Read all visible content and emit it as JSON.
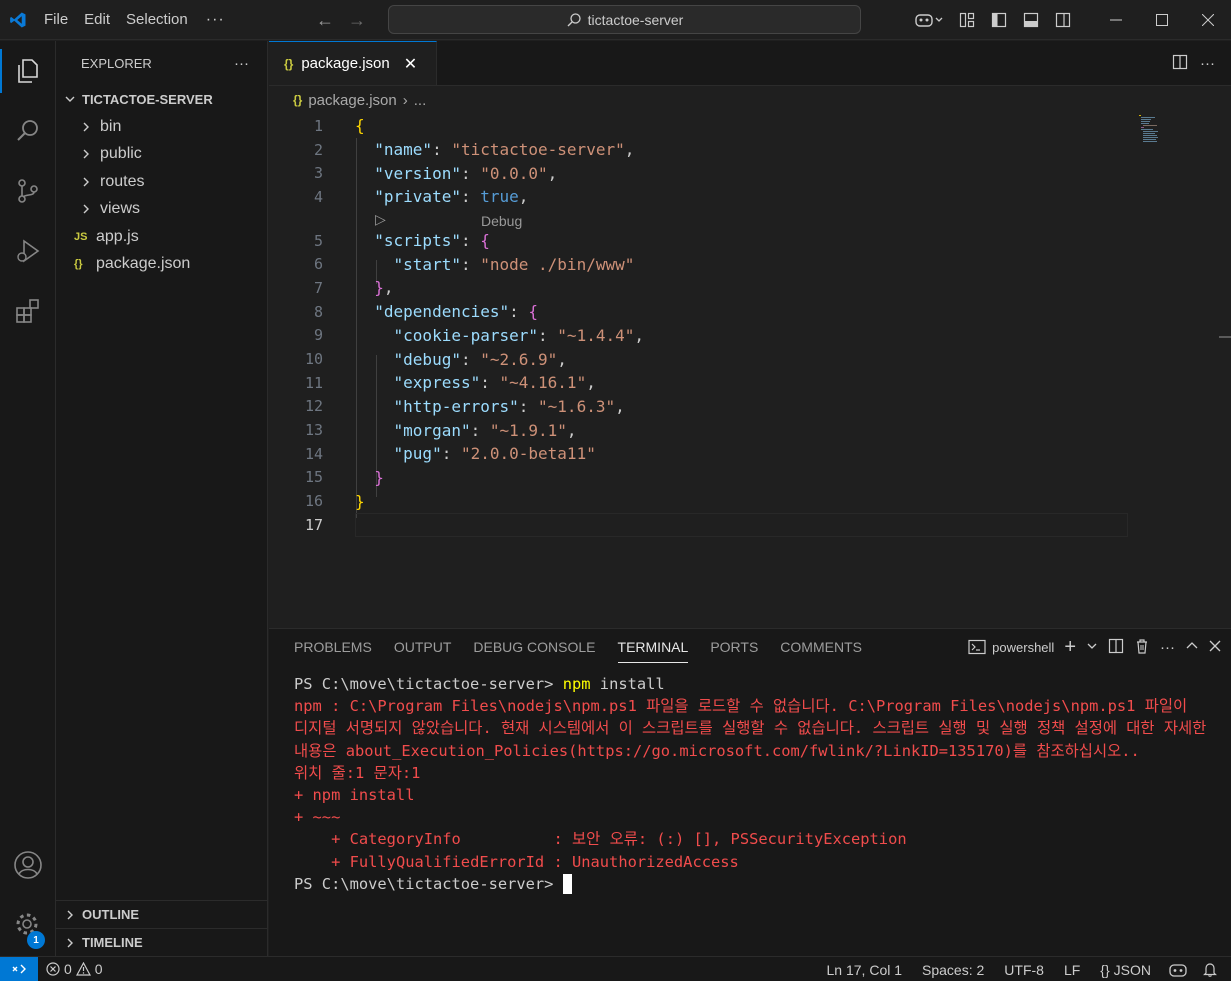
{
  "titlebar": {
    "menus": [
      "File",
      "Edit",
      "Selection"
    ],
    "more": "···",
    "search": "tictactoe-server"
  },
  "sidebar": {
    "title": "EXPLORER",
    "more": "···",
    "root": "TICTACTOE-SERVER",
    "items": [
      {
        "label": "bin",
        "type": "folder"
      },
      {
        "label": "public",
        "type": "folder"
      },
      {
        "label": "routes",
        "type": "folder"
      },
      {
        "label": "views",
        "type": "folder"
      },
      {
        "label": "app.js",
        "type": "js",
        "icon": "JS"
      },
      {
        "label": "package.json",
        "type": "json",
        "icon": "{}"
      }
    ],
    "outline": "OUTLINE",
    "timeline": "TIMELINE"
  },
  "activity": {
    "settings_badge": "1"
  },
  "editor": {
    "tab_label": "package.json",
    "tab_icon": "{}",
    "breadcrumb_file": "package.json",
    "breadcrumb_more": "...",
    "codelens": "Debug",
    "lines": [
      {
        "n": "1"
      },
      {
        "n": "2"
      },
      {
        "n": "3"
      },
      {
        "n": "4"
      },
      {
        "n": "5"
      },
      {
        "n": "6"
      },
      {
        "n": "7"
      },
      {
        "n": "8"
      },
      {
        "n": "9"
      },
      {
        "n": "10"
      },
      {
        "n": "11"
      },
      {
        "n": "12"
      },
      {
        "n": "13"
      },
      {
        "n": "14"
      },
      {
        "n": "15"
      },
      {
        "n": "16"
      },
      {
        "n": "17"
      }
    ],
    "code": {
      "name_key": "\"name\"",
      "name_val": "\"tictactoe-server\"",
      "version_key": "\"version\"",
      "version_val": "\"0.0.0\"",
      "private_key": "\"private\"",
      "private_val": "true",
      "scripts_key": "\"scripts\"",
      "start_key": "\"start\"",
      "start_val": "\"node ./bin/www\"",
      "deps_key": "\"dependencies\"",
      "d1_key": "\"cookie-parser\"",
      "d1_val": "\"~1.4.4\"",
      "d2_key": "\"debug\"",
      "d2_val": "\"~2.6.9\"",
      "d3_key": "\"express\"",
      "d3_val": "\"~4.16.1\"",
      "d4_key": "\"http-errors\"",
      "d4_val": "\"~1.6.3\"",
      "d5_key": "\"morgan\"",
      "d5_val": "\"~1.9.1\"",
      "d6_key": "\"pug\"",
      "d6_val": "\"2.0.0-beta11\""
    }
  },
  "panel": {
    "tabs": [
      "PROBLEMS",
      "OUTPUT",
      "DEBUG CONSOLE",
      "TERMINAL",
      "PORTS",
      "COMMENTS"
    ],
    "active_tab": "TERMINAL",
    "shell": "powershell",
    "terminal": {
      "prompt1": "PS C:\\move\\tictactoe-server> ",
      "cmd1_a": "npm",
      "cmd1_b": " install",
      "error": "npm : C:\\Program Files\\nodejs\\npm.ps1 파일을 로드할 수 없습니다. C:\\Program Files\\nodejs\\npm.ps1 파일이 디지털 서명되지 않았습니다. 현재 시스템에서 이 스크립트를 실행할 수 없습니다. 스크립트 실행 및 실행 정책 설정에 대한 자세한 내용은 about_Execution_Policies(https://go.microsoft.com/fwlink/?LinkID=135170)를 참조하십시오..",
      "err2": "위치 줄:1 문자:1",
      "err3": "+ npm install",
      "err4": "+ ~~~",
      "err5": "    + CategoryInfo          : 보안 오류: (:) [], PSSecurityException",
      "err6": "    + FullyQualifiedErrorId : UnauthorizedAccess",
      "prompt2": "PS C:\\move\\tictactoe-server> "
    }
  },
  "statusbar": {
    "errors": "0",
    "warnings": "0",
    "position": "Ln 17, Col 1",
    "spaces": "Spaces: 2",
    "encoding": "UTF-8",
    "eol": "LF",
    "language": "JSON",
    "language_icon": "{}"
  }
}
